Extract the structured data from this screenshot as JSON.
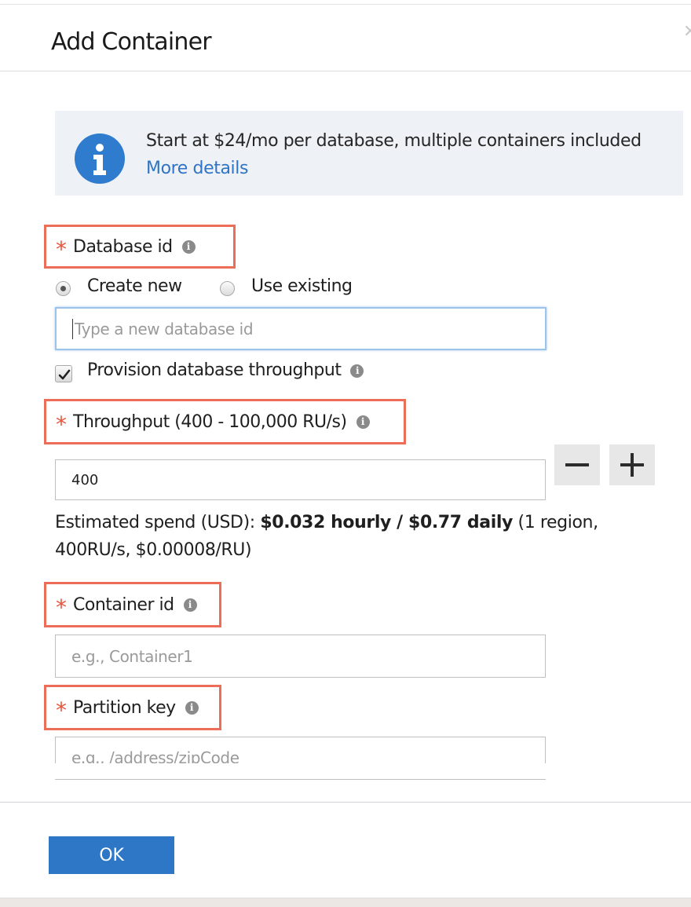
{
  "dialog": {
    "title": "Add Container",
    "close_icon": "close-icon"
  },
  "info": {
    "icon": "info-icon",
    "text": "Start at $24/mo per database, multiple containers included",
    "link": "More details"
  },
  "database": {
    "label": "Database id",
    "required_marker": "*",
    "options": [
      "Create new",
      "Use existing"
    ],
    "selected_option": "Create new",
    "placeholder": "Type a new database id",
    "value": ""
  },
  "provision": {
    "label": "Provision database throughput",
    "checked": true
  },
  "throughput": {
    "label": "Throughput (400 - 100,000 RU/s)",
    "required_marker": "*",
    "value": "400",
    "decrement_icon": "minus-icon",
    "increment_icon": "plus-icon"
  },
  "spend": {
    "prefix": "Estimated spend (USD): ",
    "bold": "$0.032 hourly / $0.77 daily",
    "suffix": " (1 region, 400RU/s, $0.00008/RU)"
  },
  "container": {
    "label": "Container id",
    "required_marker": "*",
    "placeholder": "e.g., Container1"
  },
  "partition": {
    "label": "Partition key",
    "required_marker": "*",
    "placeholder": "e.g., /address/zipCode"
  },
  "footer": {
    "ok_label": "OK"
  },
  "colors": {
    "accent": "#2e76c6",
    "required_border": "#ec6d58",
    "info_background": "#eef1f5"
  }
}
